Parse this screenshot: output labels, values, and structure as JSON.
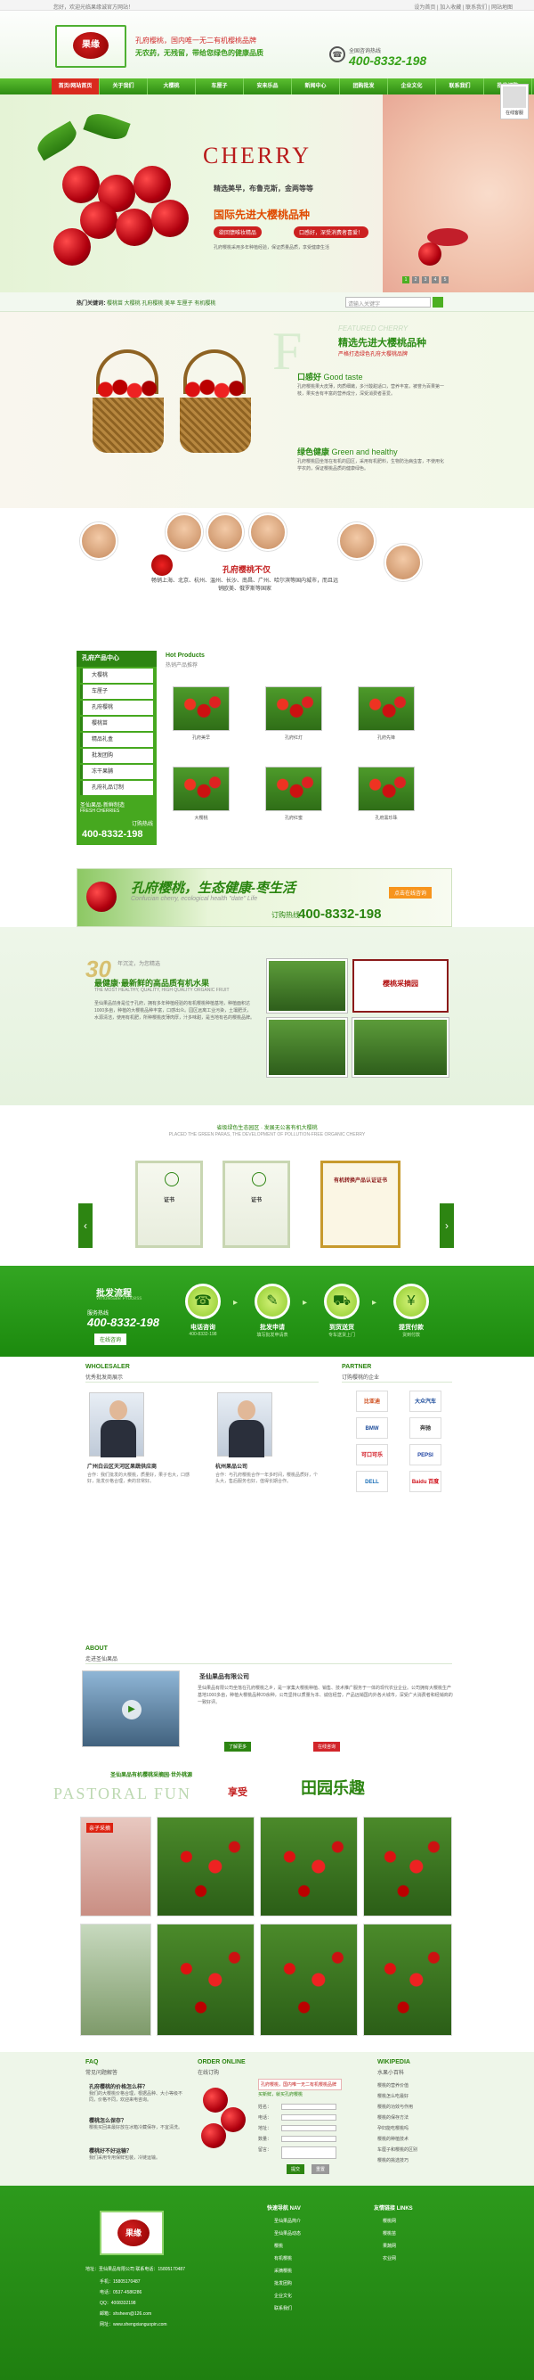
{
  "topbar": {
    "left": "您好，欢迎光临果缘诚官方网站！",
    "right": "设为首页 | 加入收藏 | 联系我们 | 网站地图"
  },
  "header": {
    "logo_text": "果缘",
    "slogan_red": "孔府樱桃，国内唯一无二有机樱桃品牌",
    "slogan_green": "无农药，无残留，带给您绿色的健康品质",
    "phone_label": "全国咨询热线",
    "phone": "400-8332-198"
  },
  "nav": [
    "首页/网站首页",
    "关于我们",
    "大樱桃",
    "车厘子",
    "安来乐品",
    "新闻中心",
    "团购批发",
    "企业文化",
    "联系我们",
    "批发订购"
  ],
  "side_help": "在线客服",
  "banner": {
    "title": "CHERRY",
    "line1": "精选美早，布鲁克斯，金两等等",
    "line2": "国际先进大樱桃品种",
    "pill1": "欲回馈唯妆精品",
    "pill2": "口感好，深受消费者喜爱！",
    "note": "孔府樱桃采用多年种植经验，保证质量品质，享受健康生活",
    "dots": [
      "1",
      "2",
      "3",
      "4",
      "5"
    ]
  },
  "crumb": {
    "label": "热门关键词：",
    "keywords": "樱桃苗 大樱桃 孔府樱桃 美早 车厘子 有机樱桃",
    "search_ph": "请输入关键字"
  },
  "featured": {
    "bigletter": "F",
    "en": "FEATURED CHERRY",
    "title": "精选先进大樱桃品种",
    "subtitle": "严格打造绿色孔府大樱桃品牌",
    "sub1": "口感好",
    "sub1_en": "Good taste",
    "p1": "孔府樱桃果大皮薄，肉质细嫩，多汁酸甜适口，营养丰富，被誉为百果第一枝，果实含有丰富的营养成分，深受消费者喜爱。",
    "sub2": "绿色健康",
    "sub2_en": "Green and healthy",
    "p2": "孔府樱桃园坐落在有机的园区，采用有机肥料，生物防治病虫害，不使用化学农药，保证樱桃品质的健康绿色。"
  },
  "people": {
    "title": "孔府樱桃不仅",
    "text": "畅销上海、北京、杭州、温州、长沙、南昌、广州、哈尔滨等国内城市，而且远销欧美、俄罗斯等国家",
    "hot_en": "Hot Products",
    "hot_cn": "热销产品推荐"
  },
  "categories": {
    "header": "孔府产品中心",
    "items": [
      "大樱桃",
      "车厘子",
      "孔府樱桃",
      "樱桃苗",
      "精品礼盒",
      "批发团购",
      "冻干果脯",
      "孔府礼品订制"
    ],
    "contact_title": "圣仙果品·新鲜制造",
    "contact_en": "FRESH CHERRIES",
    "hotline_label": "订购热线",
    "hotline": "400-8332-198"
  },
  "products": [
    {
      "cap": "孔府美早"
    },
    {
      "cap": "孔府红灯"
    },
    {
      "cap": "孔府先锋"
    },
    {
      "cap": "大樱桃"
    },
    {
      "cap": "孔府红蜜"
    },
    {
      "cap": "孔府黑珍珠"
    }
  ],
  "adbar": {
    "a1": "孔府樱桃，生态健康-枣生活",
    "a2": "Confucian cherry, ecological health \"date\" Life",
    "a3": "400-8332-198",
    "a4": "订购热线",
    "a5": "点击在线咨询"
  },
  "about": {
    "num": "30",
    "y1": "年沉淀，为您精选",
    "y2": "最健康·最新鲜的高品质有机水果",
    "y3": "THE MOST HEALTHY, QUALITY, HIGH QUALITY ORGANIC FRUIT",
    "p": "圣仙果品前身是位于孔府，拥有多年种植经验的有机樱桃种植基地，种植面积达1000多亩，种植的大樱桃品种丰富，口感出众。园区远离工业污染，土壤肥沃，水源清洁，使用有机肥，所种樱桃皮薄肉厚，汁多味甜，是当地有名的樱桃品牌。",
    "sign": "樱桃采摘园"
  },
  "certs": {
    "t1": "省级绿色生态园区 · 发展无公害有机大樱桃",
    "t2": "PLACED THE GREEN PARAS, THE DEVELOPMENT OF POLLUTION-FREE ORGANIC CHERRY",
    "labels": [
      "证书",
      "证书",
      "有机转换产品认证证书",
      "认证证书"
    ]
  },
  "process": {
    "title": "批发流程",
    "en": "Wholesale Process",
    "hotline_label": "服务热线",
    "hotline": "400-8332-198",
    "btn": "在线咨询",
    "steps": [
      {
        "t": "电话咨询",
        "s": "400-8332-198"
      },
      {
        "t": "批发申请",
        "s": "填写批发申请表"
      },
      {
        "t": "到货送货",
        "s": "专车送货上门"
      },
      {
        "t": "提货付款",
        "s": "货到付款"
      }
    ]
  },
  "wholesaler": {
    "en": "WHOLESALER",
    "cn": "优秀批发商展示",
    "p1_name": "广州白云区天河区果蔬供应商",
    "p1_txt": "合作：我们批发的大樱桃，质量好，果子也大，口感好，批发价格合理，卖的非常好。",
    "p2_name": "杭州果品公司",
    "p2_txt": "合作：与孔府樱桃合作一年多时间，樱桃品质好，个头大，售后服务也好，值得长期合作。"
  },
  "partner": {
    "en": "PARTNER",
    "cn": "订购樱桃的企业",
    "logos": [
      "比亚迪",
      "大众汽车",
      "BMW",
      "奔驰",
      "可口可乐",
      "PEPSI",
      "DELL",
      "Baidu 百度"
    ]
  },
  "company": {
    "en": "ABOUT",
    "cn": "走进圣仙果品",
    "name": "圣仙果品有限公司",
    "p": "圣仙果品有限公司坐落在孔府樱桃之乡，是一家集大樱桃种植、销售、技术推广服务于一体的现代农业企业。公司拥有大樱桃生产基地1000多亩，种植大樱桃品种20余种，公司坚持以质量为本、诚信经营，产品远销国内外各大城市，深受广大消费者和经销商的一致好评。",
    "btn1": "了解更多",
    "btn2": "在线咨询"
  },
  "pastoral": {
    "hd1": "圣仙果品有机樱桃采摘园·世外桃源",
    "hd2": "PASTORAL FUN",
    "hd3": "享受",
    "hd4": "田园乐趣",
    "photo_label": "亲子采摘"
  },
  "faq": {
    "en": "FAQ",
    "cn": "常见问题解答",
    "q1": "孔府樱桃的价格怎么样？",
    "a1": "我们的大樱桃价格合理，根据品种、大小等级不同，价格不同，欢迎来电咨询。",
    "q2": "樱桃怎么保存？",
    "a2": "樱桃买回来最好放在冰箱冷藏保存，不宜清洗。",
    "q3": "樱桃好不好运输？",
    "a3": "我们采用专用保鲜包装，冷链运输。"
  },
  "order": {
    "en": "ORDER ONLINE",
    "cn": "在线订购",
    "tip": "孔府樱桃，国内唯一无二有机樱桃品牌",
    "tip2": "买新鲜，就买孔府樱桃",
    "fields": [
      "姓名：",
      "电话：",
      "地址：",
      "数量：",
      "留言："
    ],
    "submit": "提交",
    "reset": "重置"
  },
  "wiki": {
    "en": "WIKIPEDIA",
    "cn": "水果小百科",
    "items": [
      "樱桃的营养价值",
      "樱桃怎么吃最好",
      "樱桃的功效与作用",
      "樱桃的保存方法",
      "孕妇能吃樱桃吗",
      "樱桃的种植技术",
      "车厘子和樱桃的区别",
      "樱桃的挑选技巧"
    ]
  },
  "footer": {
    "nav_h": "快速导航 NAV",
    "nav": [
      "圣仙果品简介",
      "圣仙果品动态",
      "樱桃",
      "有机樱桃",
      "采摘樱桃",
      "批发团购",
      "企业文化",
      "联系我们"
    ],
    "links_h": "友情链接 LINKS",
    "links": [
      "樱桃网",
      "樱桃苗",
      "果蔬网",
      "农业网"
    ],
    "addr": "地址：圣仙果品有限公司 联系电话：15805170487",
    "tel1": "手机：15805170487",
    "tel2": "电话：0537-4586286",
    "qq": "QQ：4008332198",
    "email": "邮箱：shsheen@126.com",
    "web": "网址：www.shengxianguopin.com"
  }
}
